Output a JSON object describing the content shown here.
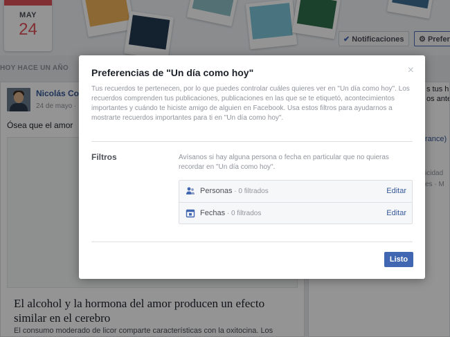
{
  "calendar": {
    "month": "MAY",
    "day": "24"
  },
  "header": {
    "notifications_label": "Notificaciones",
    "preferences_label": "Preferencias"
  },
  "feed": {
    "section_title": "HOY HACE UN AÑO",
    "post": {
      "author": "Nicolás Co",
      "date": "24 de mayo ·",
      "text": "Ósea que el amor",
      "article_title": "El alcohol y la hormona del amor producen un efecto similar en el cerebro",
      "article_desc": "El consumo moderado de licor comparte características con la oxitocina. Los"
    },
    "right_column": {
      "line1": "s tus his",
      "line2": "os ante",
      "link": "rance)",
      "line3": "icidad",
      "line4": "es · M"
    }
  },
  "modal": {
    "title": "Preferencias de \"Un día como hoy\"",
    "close_symbol": "×",
    "intro": "Tus recuerdos te pertenecen, por lo que puedes controlar cuáles quieres ver en \"Un día como hoy\". Los recuerdos comprenden tus publicaciones, publicaciones en las que se te etiquetó, acontecimientos importantes y cuándo te hiciste amigo de alguien en Facebook. Usa estos filtros para ayudarnos a mostrarte recuerdos importantes para ti en \"Un día como hoy\".",
    "filters_label": "Filtros",
    "filters_help": "Avísanos si hay alguna persona o fecha en particular que no quieras recordar en \"Un día como hoy\".",
    "filters": [
      {
        "name": "Personas",
        "count": " · 0 filtrados",
        "edit_label": "Editar",
        "icon": "people-icon"
      },
      {
        "name": "Fechas",
        "count": " · 0 filtrados",
        "edit_label": "Editar",
        "icon": "calendar-icon"
      }
    ],
    "done_label": "Listo"
  },
  "colors": {
    "accent": "#4267b2",
    "link": "#365899",
    "calendar_red": "#e0525a"
  }
}
